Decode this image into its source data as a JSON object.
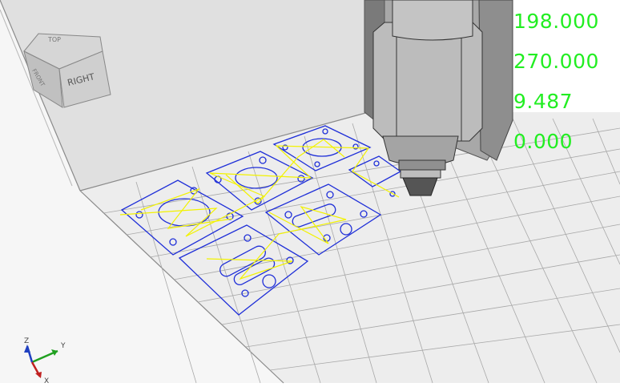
{
  "viewport": {
    "background": "#e8e8e8",
    "grid_color": "#9a9a9a",
    "toolpath_outline_color": "#1f2fd8",
    "toolpath_rapid_color": "#f2f200",
    "readout_color": "#22ee22"
  },
  "view_cube": {
    "face_label": "RIGHT",
    "top_label": "TOP",
    "left_label": "FRONT"
  },
  "axis_triad": {
    "x_label": "X",
    "y_label": "Y",
    "z_label": "Z",
    "x_color": "#c02020",
    "y_color": "#20a020",
    "z_color": "#2040c0"
  },
  "readout": {
    "x": "198.000",
    "y": "270.000",
    "z": "9.487",
    "a": "0.000"
  }
}
